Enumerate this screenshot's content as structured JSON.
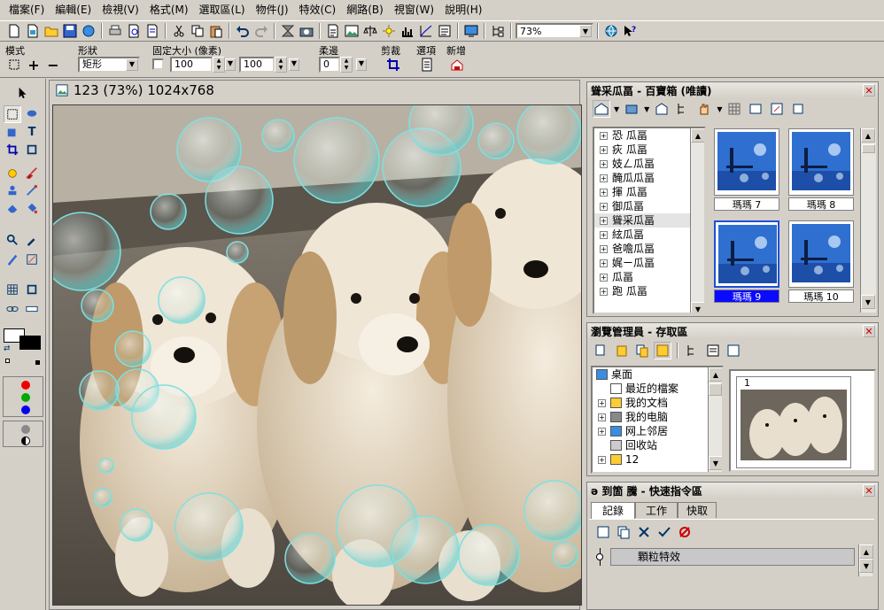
{
  "menu": [
    "檔案(F)",
    "編輯(E)",
    "檢視(V)",
    "格式(M)",
    "選取區(L)",
    "物件(J)",
    "特效(C)",
    "網路(B)",
    "視窗(W)",
    "說明(H)"
  ],
  "toolbar": {
    "zoom_value": "73%"
  },
  "props": {
    "mode_label": "模式",
    "shape_label": "形狀",
    "shape_value": "矩形",
    "fixed_size_label": "固定大小 (像素)",
    "width_value": "100",
    "height_value": "100",
    "soft_label": "柔邊",
    "soft_value": "0",
    "crop_label": "剪裁",
    "options_label": "選項",
    "new_label": "新增"
  },
  "document": {
    "title": "123 (73%) 1024x768"
  },
  "easy_palette": {
    "title": "聳采瓜畐 - 百寶箱 (唯讀)",
    "tree_items": [
      "恐  瓜畐",
      "疢  瓜畐",
      "妓ㄥ瓜畐",
      "醃瓜瓜畐",
      "揮  瓜畐",
      "   御瓜畐",
      "聳采瓜畐",
      "   絃瓜畐",
      "爸噡瓜畐",
      "     娓ㄧ瓜畐",
      "     瓜畐",
      "跑  瓜畐"
    ],
    "selected_tree_index": 6,
    "thumbs": [
      "瑪瑪 7",
      "瑪瑪 8",
      "瑪瑪 9",
      "瑪瑪 10"
    ],
    "selected_thumb_index": 2
  },
  "explorer": {
    "title": "瀏覽管理員 - 存取區",
    "tree_items": [
      "桌面",
      "最近的檔案",
      "我的文档",
      "我的电脑",
      "网上邻居",
      "回收站",
      "12"
    ],
    "preview_label": "1"
  },
  "quick_command": {
    "title": "ə 到箇  騰      - 快速指令區",
    "tabs": [
      "記錄",
      "工作",
      "快取"
    ],
    "active_tab": 0,
    "record_item": "顆粒特效"
  },
  "colors": {
    "accent_blue": "#0a0aff",
    "select_blue": "#1e50d8",
    "titlebar": "#d4d0c8"
  }
}
